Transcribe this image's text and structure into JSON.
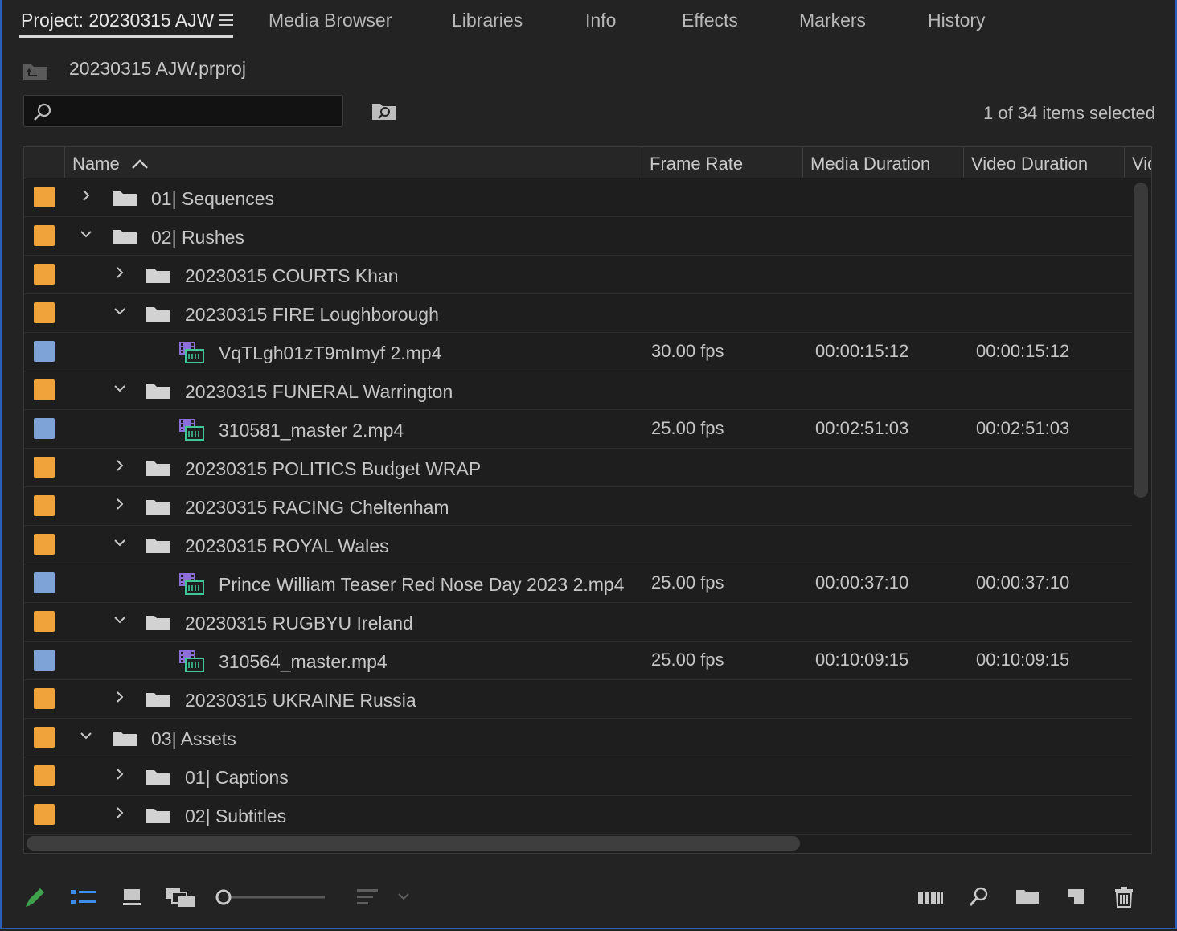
{
  "tabs": [
    {
      "label": "Project: 20230315 AJW",
      "active": true
    },
    {
      "label": "Media Browser"
    },
    {
      "label": "Libraries"
    },
    {
      "label": "Info"
    },
    {
      "label": "Effects"
    },
    {
      "label": "Markers"
    },
    {
      "label": "History"
    }
  ],
  "project": {
    "file_name": "20230315 AJW.prproj"
  },
  "search": {
    "value": "",
    "placeholder": ""
  },
  "selection_status": "1 of 34 items selected",
  "columns": {
    "name": "Name",
    "frame_rate": "Frame Rate",
    "media_duration": "Media Duration",
    "video_duration": "Video Duration",
    "video_partial": "Vid"
  },
  "sort": {
    "column": "Name",
    "direction": "ascending"
  },
  "colors": {
    "folder_label": "#f0a23b",
    "clip_label": "#7ea3d6",
    "accent": "#2d5fb8"
  },
  "rows": [
    {
      "name": "01| Sequences",
      "kind": "folder",
      "depth": 0,
      "expanded": false
    },
    {
      "name": "02| Rushes",
      "kind": "folder",
      "depth": 0,
      "expanded": true
    },
    {
      "name": "20230315 COURTS Khan",
      "kind": "folder",
      "depth": 1,
      "expanded": false
    },
    {
      "name": "20230315 FIRE Loughborough",
      "kind": "folder",
      "depth": 1,
      "expanded": true
    },
    {
      "name": "VqTLgh01zT9mImyf 2.mp4",
      "kind": "clip",
      "depth": 2,
      "frame_rate": "30.00 fps",
      "media_duration": "00:00:15:12",
      "video_duration": "00:00:15:12"
    },
    {
      "name": "20230315 FUNERAL Warrington",
      "kind": "folder",
      "depth": 1,
      "expanded": true
    },
    {
      "name": "310581_master 2.mp4",
      "kind": "clip",
      "depth": 2,
      "frame_rate": "25.00 fps",
      "media_duration": "00:02:51:03",
      "video_duration": "00:02:51:03"
    },
    {
      "name": "20230315 POLITICS Budget WRAP",
      "kind": "folder",
      "depth": 1,
      "expanded": false
    },
    {
      "name": "20230315 RACING Cheltenham",
      "kind": "folder",
      "depth": 1,
      "expanded": false
    },
    {
      "name": "20230315 ROYAL Wales",
      "kind": "folder",
      "depth": 1,
      "expanded": true
    },
    {
      "name": "Prince William Teaser   Red Nose Day 2023 2.mp4",
      "kind": "clip",
      "depth": 2,
      "frame_rate": "25.00 fps",
      "media_duration": "00:00:37:10",
      "video_duration": "00:00:37:10"
    },
    {
      "name": "20230315 RUGBYU Ireland",
      "kind": "folder",
      "depth": 1,
      "expanded": true
    },
    {
      "name": "310564_master.mp4",
      "kind": "clip",
      "depth": 2,
      "frame_rate": "25.00 fps",
      "media_duration": "00:10:09:15",
      "video_duration": "00:10:09:15"
    },
    {
      "name": "20230315 UKRAINE Russia",
      "kind": "folder",
      "depth": 1,
      "expanded": false
    },
    {
      "name": "03| Assets",
      "kind": "folder",
      "depth": 0,
      "expanded": true
    },
    {
      "name": "01| Captions",
      "kind": "folder",
      "depth": 1,
      "expanded": false
    },
    {
      "name": "02| Subtitles",
      "kind": "folder",
      "depth": 1,
      "expanded": false
    }
  ],
  "toolbar": {
    "left": [
      "pencil-icon",
      "list-view-icon",
      "icon-view-icon",
      "freeform-view-icon",
      "zoom-slider",
      "sort-icon",
      "sort-dropdown-icon"
    ],
    "right": [
      "automate-to-sequence-icon",
      "find-icon",
      "new-bin-icon",
      "new-item-icon",
      "trash-icon"
    ],
    "zoom_level": 0
  }
}
